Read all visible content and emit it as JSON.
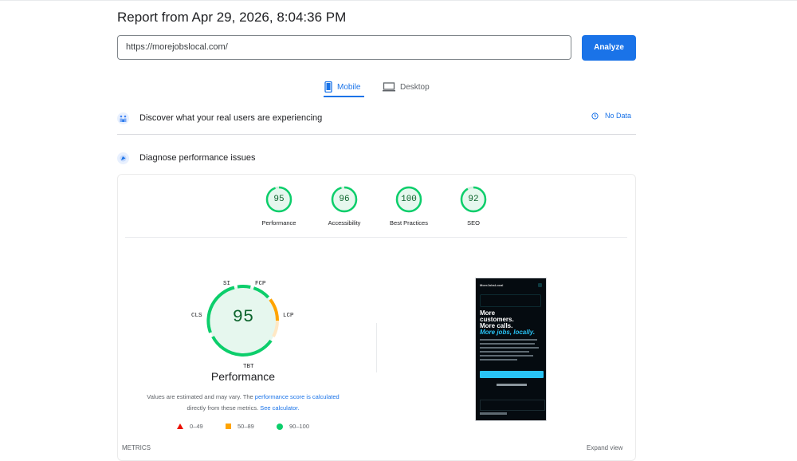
{
  "report": {
    "title": "Report from Apr 29, 2026, 8:04:36 PM",
    "url_value": "https://morejobslocal.com/",
    "analyze_label": "Analyze"
  },
  "tabs": [
    {
      "label": "Mobile",
      "active": true,
      "icon": "mobile-phone-icon"
    },
    {
      "label": "Desktop",
      "active": false,
      "icon": "desktop-monitor-icon"
    }
  ],
  "sections": {
    "field_data": {
      "label": "Discover what your real users are experiencing",
      "status": "No Data",
      "icon": "crux-users-icon"
    },
    "lab_data": {
      "label": "Diagnose performance issues",
      "icon": "lighthouse-icon"
    }
  },
  "categories": [
    {
      "label": "Performance",
      "score": "95",
      "value": 0.95
    },
    {
      "label": "Accessibility",
      "score": "96",
      "value": 0.96
    },
    {
      "label": "Best Practices",
      "score": "100",
      "value": 1.0
    },
    {
      "label": "SEO",
      "score": "92",
      "value": 0.92
    }
  ],
  "performance": {
    "score": "95",
    "title": "Performance",
    "metrics": [
      "SI",
      "FCP",
      "LCP",
      "TBT",
      "CLS"
    ],
    "note_prefix": "Values are estimated and may vary. The",
    "note_link1": "performance score is calculated",
    "note_middle": "directly from these metrics.",
    "note_link2": "See calculator."
  },
  "legend": [
    {
      "range": "0–49",
      "color": "#eb0f00",
      "shape": "triangle"
    },
    {
      "range": "50–89",
      "color": "#ffa400",
      "shape": "square"
    },
    {
      "range": "90–100",
      "color": "#0cce6b",
      "shape": "circle"
    }
  ],
  "screenshot": {
    "logo": "MoreJobsLocal",
    "headline": [
      "More",
      "customers.",
      "More calls."
    ],
    "subline": [
      "More jobs,",
      "locally."
    ]
  },
  "footer": {
    "metrics_label": "METRICS",
    "expand_label": "Expand view"
  },
  "colors": {
    "accent": "#1a73e8",
    "pass": "#0cce6b",
    "average": "#ffa400",
    "fail": "#eb0f00"
  }
}
